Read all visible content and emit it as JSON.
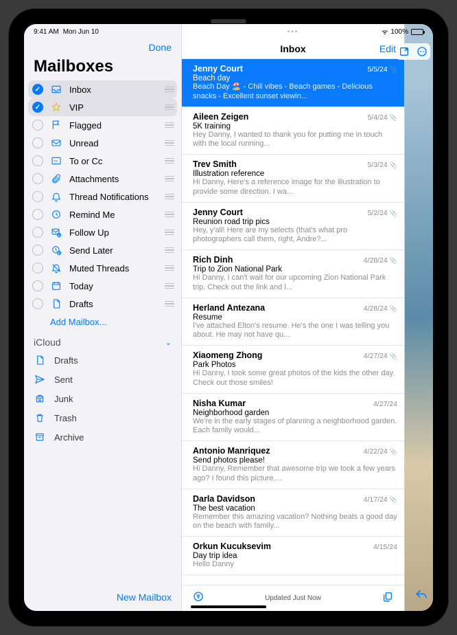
{
  "status": {
    "time": "9:41 AM",
    "date": "Mon Jun 10",
    "battery": "100%"
  },
  "sidebar": {
    "done": "Done",
    "title": "Mailboxes",
    "add": "Add Mailbox...",
    "newMailbox": "New Mailbox",
    "account": "iCloud",
    "items": [
      {
        "id": "inbox",
        "label": "Inbox",
        "checked": true,
        "icon": "inbox"
      },
      {
        "id": "vip",
        "label": "VIP",
        "checked": true,
        "icon": "star"
      },
      {
        "id": "flagged",
        "label": "Flagged",
        "checked": false,
        "icon": "flag"
      },
      {
        "id": "unread",
        "label": "Unread",
        "checked": false,
        "icon": "envelope"
      },
      {
        "id": "tocc",
        "label": "To or Cc",
        "checked": false,
        "icon": "tocc"
      },
      {
        "id": "attachments",
        "label": "Attachments",
        "checked": false,
        "icon": "paperclip"
      },
      {
        "id": "thread",
        "label": "Thread Notifications",
        "checked": false,
        "icon": "bell"
      },
      {
        "id": "remind",
        "label": "Remind Me",
        "checked": false,
        "icon": "clock"
      },
      {
        "id": "followup",
        "label": "Follow Up",
        "checked": false,
        "icon": "envelope-arrow"
      },
      {
        "id": "sendlater",
        "label": "Send Later",
        "checked": false,
        "icon": "clock-arrow"
      },
      {
        "id": "muted",
        "label": "Muted Threads",
        "checked": false,
        "icon": "bell-slash"
      },
      {
        "id": "today",
        "label": "Today",
        "checked": false,
        "icon": "calendar"
      },
      {
        "id": "drafts",
        "label": "Drafts",
        "checked": false,
        "icon": "doc"
      }
    ],
    "accountItems": [
      {
        "id": "a-drafts",
        "label": "Drafts",
        "icon": "doc"
      },
      {
        "id": "a-sent",
        "label": "Sent",
        "icon": "send"
      },
      {
        "id": "a-junk",
        "label": "Junk",
        "icon": "junk"
      },
      {
        "id": "a-trash",
        "label": "Trash",
        "icon": "trash"
      },
      {
        "id": "a-archive",
        "label": "Archive",
        "icon": "archive"
      }
    ]
  },
  "inbox": {
    "title": "Inbox",
    "edit": "Edit",
    "updated": "Updated Just Now",
    "messages": [
      {
        "sender": "Jenny Court",
        "date": "5/5/24",
        "subject": "Beach day",
        "preview": "Beach Day 🏖️ - Chill vibes - Beach games - Delicious snacks - Excellent sunset viewin...",
        "attach": true,
        "selected": true
      },
      {
        "sender": "Aileen Zeigen",
        "date": "5/4/24",
        "subject": "5K training",
        "preview": "Hey Danny, I wanted to thank you for putting me in touch with the local running...",
        "attach": true
      },
      {
        "sender": "Trev Smith",
        "date": "5/3/24",
        "subject": "Illustration reference",
        "preview": "Hi Danny, Here's a reference image for the illustration to provide some direction. I wa...",
        "attach": true
      },
      {
        "sender": "Jenny Court",
        "date": "5/2/24",
        "subject": "Reunion road trip pics",
        "preview": "Hey, y'all! Here are my selects (that's what pro photographers call them, right, Andre?...",
        "attach": true
      },
      {
        "sender": "Rich Dinh",
        "date": "4/28/24",
        "subject": "Trip to Zion National Park",
        "preview": "Hi Danny, I can't wait for our upcoming Zion National Park trip. Check out the link and l...",
        "attach": true
      },
      {
        "sender": "Herland Antezana",
        "date": "4/28/24",
        "subject": "Resume",
        "preview": "I've attached Elton's resume. He's the one I was telling you about. He may not have qu...",
        "attach": true
      },
      {
        "sender": "Xiaomeng Zhong",
        "date": "4/27/24",
        "subject": "Park Photos",
        "preview": "Hi Danny, I took some great photos of the kids the other day. Check out those smiles!",
        "attach": true
      },
      {
        "sender": "Nisha Kumar",
        "date": "4/27/24",
        "subject": "Neighborhood garden",
        "preview": "We're in the early stages of planning a neighborhood garden. Each family would..."
      },
      {
        "sender": "Antonio Manriquez",
        "date": "4/22/24",
        "subject": "Send photos please!",
        "preview": "Hi Danny, Remember that awesome trip we took a few years ago? I found this picture,...",
        "attach": true
      },
      {
        "sender": "Darla Davidson",
        "date": "4/17/24",
        "subject": "The best vacation",
        "preview": "Remember this amazing vacation? Nothing beats a good day on the beach with family...",
        "attach": true
      },
      {
        "sender": "Orkun Kucuksevim",
        "date": "4/15/24",
        "subject": "Day trip idea",
        "preview": "Hello Danny"
      }
    ]
  }
}
